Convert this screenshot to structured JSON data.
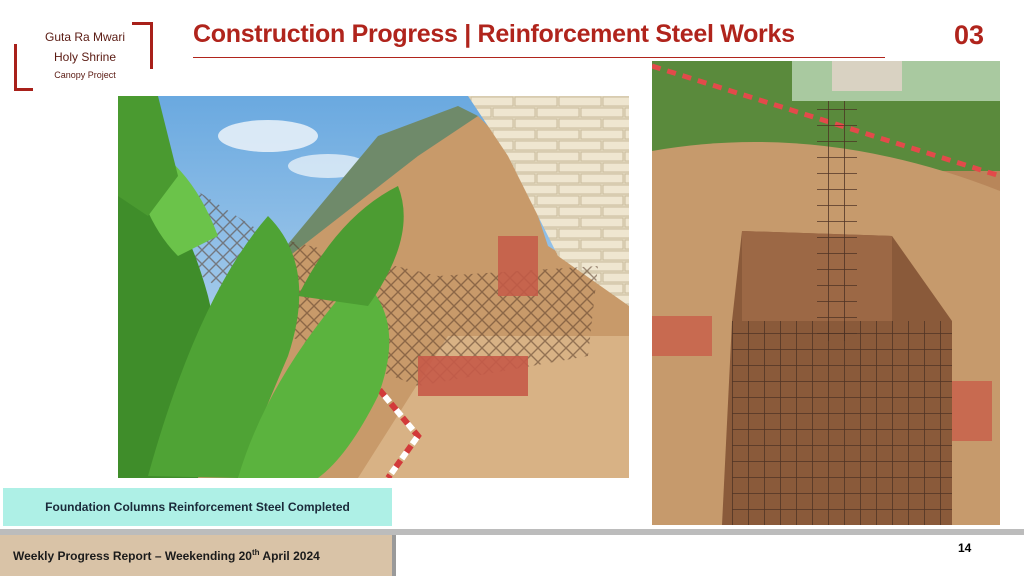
{
  "logo": {
    "line1": "Guta Ra Mwari",
    "line2": "Holy Shrine",
    "line3": "Canopy Project",
    "color": "#a8201a"
  },
  "header": {
    "title": "Construction Progress | Reinforcement Steel Works",
    "section_number": "03",
    "accent_color": "#b0241c"
  },
  "photos": [
    {
      "name": "rebar-cage-by-brick-wall",
      "icon": "photo"
    },
    {
      "name": "rebar-cage-in-excavation-pit",
      "icon": "photo"
    }
  ],
  "caption": {
    "text": "Foundation Columns Reinforcement Steel  Completed",
    "background": "#aef0e6"
  },
  "footer": {
    "report_prefix": "Weekly Progress Report – Weekending 20",
    "report_sup": "th",
    "report_suffix": " April 2024",
    "page_number": "14"
  }
}
